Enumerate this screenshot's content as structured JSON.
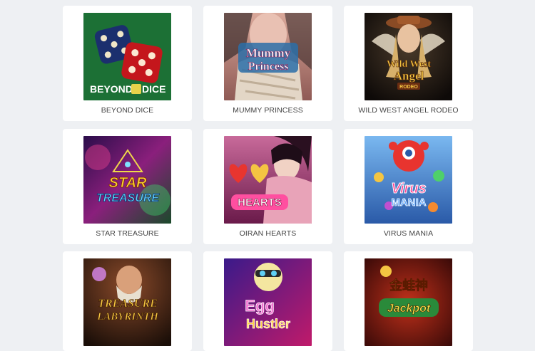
{
  "games": [
    {
      "title": "BEYOND DICE",
      "art_text": [
        "BEYOND",
        "DICE"
      ]
    },
    {
      "title": "MUMMY PRINCESS",
      "art_text": [
        "Mummy",
        "Princess"
      ]
    },
    {
      "title": "WILD WEST ANGEL RODEO",
      "art_text": [
        "Wild West",
        "Angel",
        "RODEO"
      ]
    },
    {
      "title": "STAR TREASURE",
      "art_text": [
        "STAR",
        "TREASURE"
      ]
    },
    {
      "title": "OIRAN HEARTS",
      "art_text": [
        "HEARTS"
      ]
    },
    {
      "title": "VIRUS MANIA",
      "art_text": [
        "Virus",
        "MANIA"
      ]
    },
    {
      "title": "",
      "art_text": [
        "TREASURE",
        "LABYRINTH"
      ]
    },
    {
      "title": "",
      "art_text": [
        "Egg",
        "Hustler"
      ]
    },
    {
      "title": "",
      "art_text": [
        "金蛙神",
        "Jackpot"
      ]
    }
  ],
  "colors": {
    "page_bg": "#eef0f3",
    "card_bg": "#ffffff",
    "title_text": "#444444"
  }
}
